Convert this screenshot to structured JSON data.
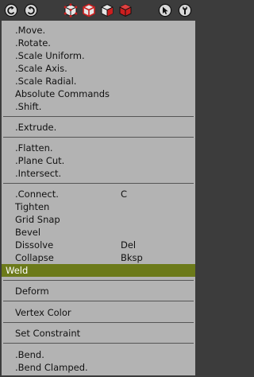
{
  "toolbar": {
    "icons": [
      "undo-icon",
      "redo-icon",
      "cube-select-icon",
      "cube-edge-icon",
      "cube-face-icon",
      "cube-solid-icon",
      "pointer-icon",
      "wrench-icon"
    ],
    "accent": "#cc1f1f"
  },
  "menu": {
    "highlight_color": "#6c7a1a",
    "groups": [
      [
        {
          "label": ".Move.",
          "shortcut": ""
        },
        {
          "label": ".Rotate.",
          "shortcut": ""
        },
        {
          "label": ".Scale Uniform.",
          "shortcut": ""
        },
        {
          "label": ".Scale Axis.",
          "shortcut": ""
        },
        {
          "label": ".Scale Radial.",
          "shortcut": ""
        },
        {
          "label": "Absolute Commands",
          "shortcut": ""
        },
        {
          "label": ".Shift.",
          "shortcut": ""
        }
      ],
      [
        {
          "label": ".Extrude.",
          "shortcut": ""
        }
      ],
      [
        {
          "label": ".Flatten.",
          "shortcut": ""
        },
        {
          "label": ".Plane Cut.",
          "shortcut": ""
        },
        {
          "label": ".Intersect.",
          "shortcut": ""
        }
      ],
      [
        {
          "label": ".Connect.",
          "shortcut": "C"
        },
        {
          "label": "Tighten",
          "shortcut": ""
        },
        {
          "label": "Grid Snap",
          "shortcut": ""
        },
        {
          "label": "Bevel",
          "shortcut": ""
        },
        {
          "label": "Dissolve",
          "shortcut": "Del"
        },
        {
          "label": "Collapse",
          "shortcut": "Bksp"
        },
        {
          "label": "Weld",
          "shortcut": "",
          "active": true
        }
      ],
      [
        {
          "label": "Deform",
          "shortcut": ""
        }
      ],
      [
        {
          "label": "Vertex Color",
          "shortcut": ""
        }
      ],
      [
        {
          "label": "Set Constraint",
          "shortcut": ""
        }
      ],
      [
        {
          "label": ".Bend.",
          "shortcut": ""
        },
        {
          "label": ".Bend Clamped.",
          "shortcut": ""
        }
      ]
    ]
  }
}
